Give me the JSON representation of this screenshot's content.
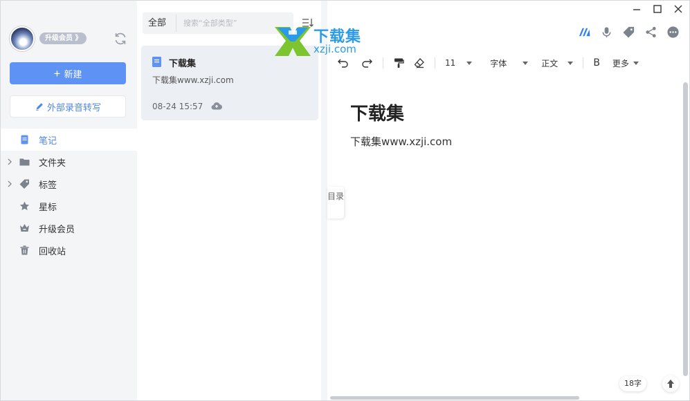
{
  "sidebar": {
    "vip_badge": "升级会员 》",
    "new_label": "新建",
    "transcribe_label": "外部录音转写",
    "nav": [
      {
        "label": "笔记"
      },
      {
        "label": "文件夹"
      },
      {
        "label": "标签"
      },
      {
        "label": "星标"
      },
      {
        "label": "升级会员"
      },
      {
        "label": "回收站"
      }
    ]
  },
  "list": {
    "filter_label": "全部",
    "search_placeholder": "搜索“全部类型”",
    "notes": [
      {
        "title": "下载集",
        "snippet": "下载集www.xzji.com",
        "date": "08-24 15:57"
      }
    ]
  },
  "watermark": {
    "brand": "下载集",
    "url": "xzji.com"
  },
  "editor": {
    "font_size": "11",
    "font_family": "字体",
    "paragraph_style": "正文",
    "bold_label": "B",
    "more_label": "更多",
    "doc_title": "下载集",
    "doc_body": "下载集www.xzji.com",
    "toc_label": "目录",
    "word_count": "18字"
  },
  "colors": {
    "accent": "#5e93f5",
    "active_text": "#4f86ee",
    "sidebar_bg": "#f4f5f7",
    "card_bg": "#eceff4"
  }
}
